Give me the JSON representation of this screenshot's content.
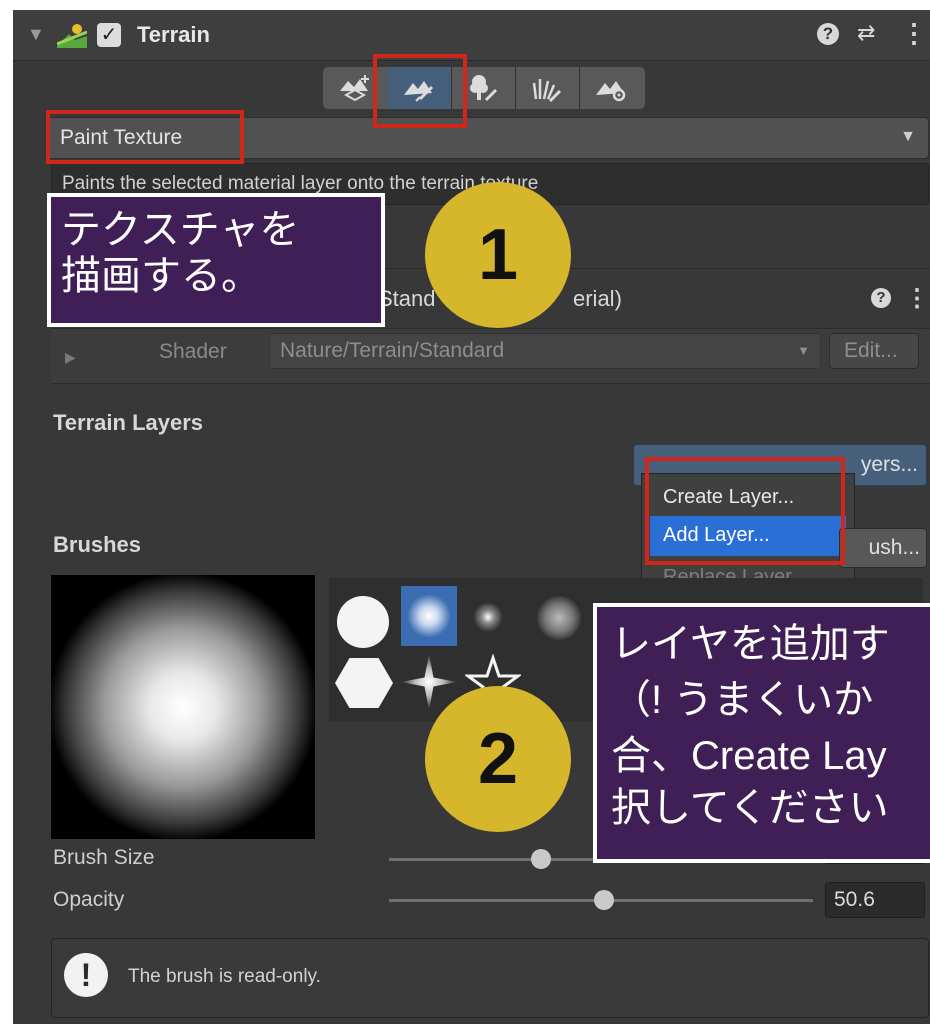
{
  "header": {
    "title": "Terrain",
    "help_glyph": "?",
    "presets_glyph": "⇄",
    "menu_glyph": "⋮"
  },
  "toolbar": {
    "tools": [
      "create-neighbor-terrains",
      "paint-terrain",
      "paint-trees",
      "paint-details",
      "terrain-settings"
    ],
    "active_index": 1
  },
  "tool_select": {
    "value": "Paint Texture",
    "description": "Paints the selected material layer onto the terrain texture"
  },
  "material": {
    "name_fragment_1": "Stand",
    "name_fragment_2": "erial)",
    "shader_label": "Shader",
    "shader_value": "Nature/Terrain/Standard",
    "edit_label": "Edit..."
  },
  "terrain_layers": {
    "title": "Terrain Layers",
    "edit_button": "yers..."
  },
  "context_menu": {
    "items": [
      {
        "label": "Create Layer...",
        "state": "normal"
      },
      {
        "label": "Add Layer...",
        "state": "highlighted"
      },
      {
        "label": "Replace Layer...",
        "state": "disabled"
      }
    ]
  },
  "brushes": {
    "title": "Brushes",
    "new_brush_button": "ush...",
    "size_label": "Brush Size",
    "size_value": "25",
    "opacity_label": "Opacity",
    "opacity_value": "50.6",
    "opacity_fraction": 0.506,
    "read_only_message": "The brush is read-only."
  },
  "annotations": {
    "callout1_line1": "テクスチャを",
    "callout1_line2": "描画する。",
    "step1": "1",
    "callout2_line1": "レイヤを追加す",
    "callout2_line2": "（! うまくいか",
    "callout2_line3": "合、Create Lay",
    "callout2_line4": "択してください",
    "step2": "2"
  },
  "colors": {
    "panel_bg": "#383838",
    "highlight_blue": "#2a6fd6",
    "annotation_red": "#d0271a",
    "callout_purple": "#3f1f55",
    "step_yellow": "#d6b62a"
  }
}
